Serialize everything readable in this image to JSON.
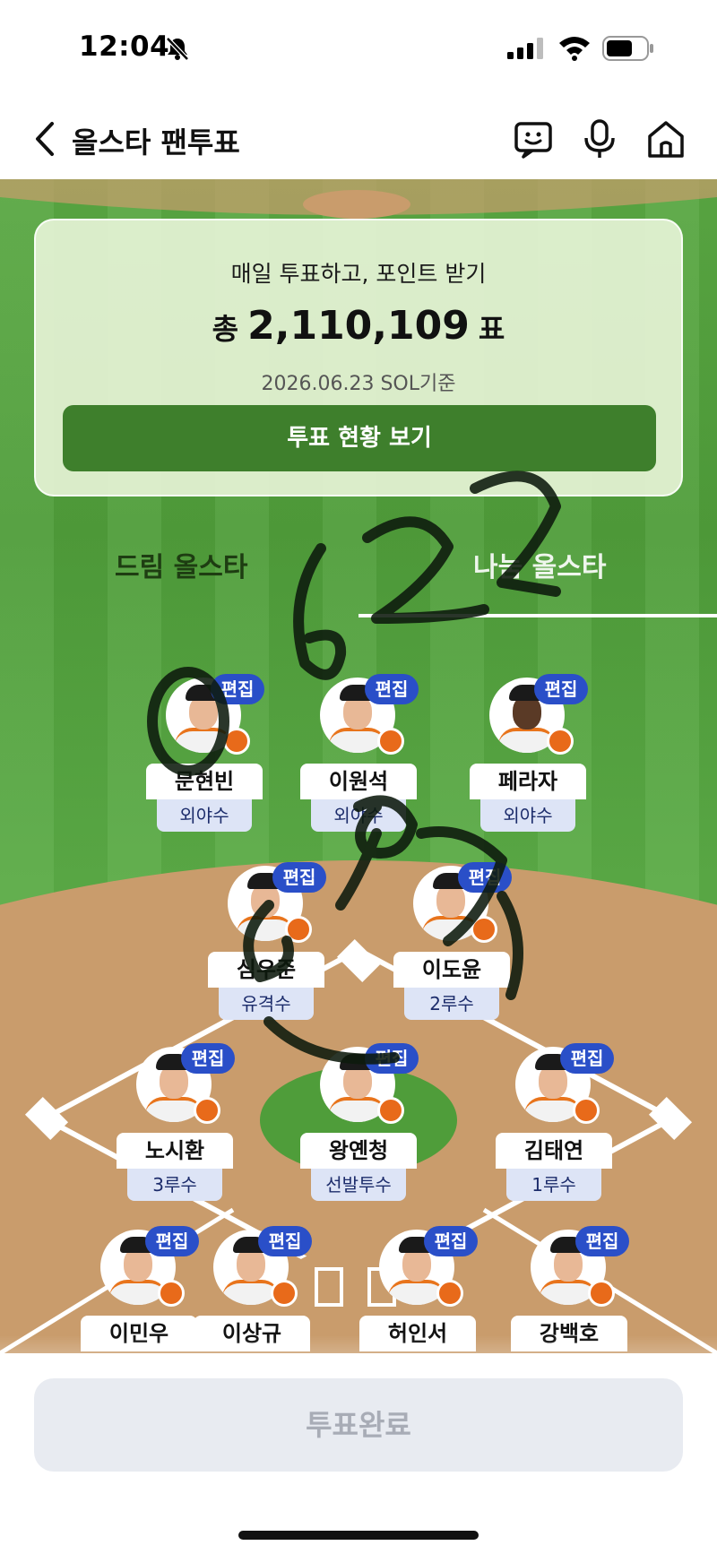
{
  "status_bar": {
    "time": "12:04"
  },
  "nav": {
    "title": "올스타 팬투표"
  },
  "summary": {
    "subtitle": "매일 투표하고, 포인트 받기",
    "total_prefix": "총",
    "total_votes": "2,110,109",
    "total_suffix": "표",
    "date": "2026.06.23 SOL기준",
    "status_button": "투표 현황 보기"
  },
  "tabs": [
    {
      "label": "드림 올스타",
      "selected": false
    },
    {
      "label": "나눔 올스타",
      "selected": true
    }
  ],
  "edit_label": "편집",
  "players": [
    {
      "name": "문현빈",
      "position": "외야수"
    },
    {
      "name": "이원석",
      "position": "외야수"
    },
    {
      "name": "페라자",
      "position": "외야수"
    },
    {
      "name": "심우준",
      "position": "유격수"
    },
    {
      "name": "이도윤",
      "position": "2루수"
    },
    {
      "name": "노시환",
      "position": "3루수"
    },
    {
      "name": "왕옌청",
      "position": "선발투수"
    },
    {
      "name": "김태연",
      "position": "1루수"
    },
    {
      "name": "이민우",
      "position": ""
    },
    {
      "name": "이상규",
      "position": ""
    },
    {
      "name": "허인서",
      "position": ""
    },
    {
      "name": "강백호",
      "position": ""
    }
  ],
  "complete_button": "투표완료",
  "colors": {
    "edit_tag": "#2a4fc8",
    "status_button": "#3e7f2c",
    "field_green": "#5aa843",
    "infield_dirt": "#c99c6c"
  }
}
